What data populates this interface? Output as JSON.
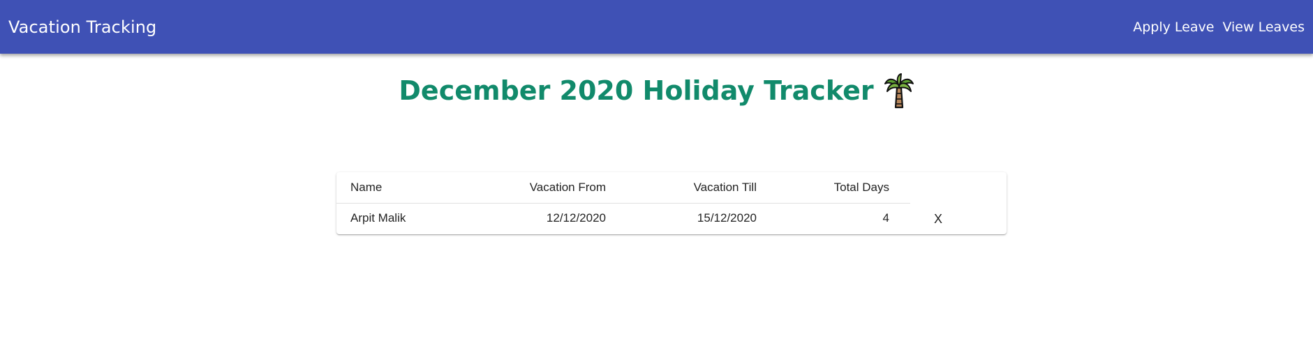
{
  "app_bar": {
    "title": "Vacation Tracking",
    "background": "#3f51b5",
    "nav": [
      {
        "label": "Apply Leave"
      },
      {
        "label": "View Leaves"
      }
    ]
  },
  "page": {
    "heading": "December 2020 Holiday Tracker",
    "heading_color": "#118a6b",
    "heading_icon": "palm-tree-icon"
  },
  "table": {
    "columns": [
      "Name",
      "Vacation From",
      "Vacation Till",
      "Total Days"
    ],
    "rows": [
      {
        "name": "Arpit Malik",
        "from": "12/12/2020",
        "till": "15/12/2020",
        "days": "4",
        "delete_label": "X"
      }
    ]
  }
}
